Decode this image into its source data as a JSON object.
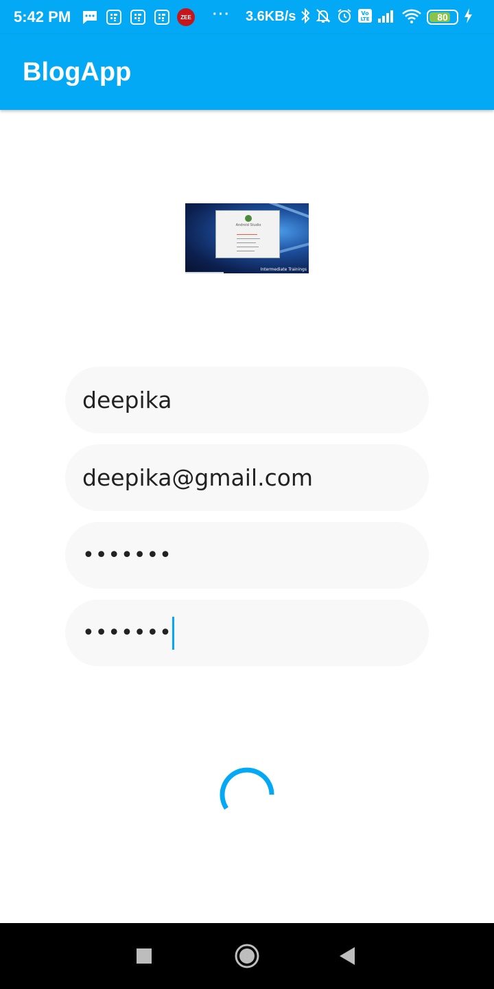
{
  "status_bar": {
    "time": "5:42 PM",
    "notification_icons": [
      "message-icon",
      "sim-icon",
      "sim-icon",
      "sim-icon",
      "zee-icon"
    ],
    "zee_label": "ZEE",
    "more": "···",
    "net_speed": "3.6KB/s",
    "right_icons": [
      "bluetooth-icon",
      "mute-icon",
      "alarm-icon",
      "volte-icon",
      "signal-icon",
      "wifi-icon"
    ],
    "battery": {
      "level_percent": 80,
      "label": "80"
    }
  },
  "app_bar": {
    "title": "BlogApp"
  },
  "logo": {
    "window_title": "Android Studio",
    "caption": "Intermediate Trainings"
  },
  "form": {
    "name_value": "deepika",
    "email_value": "deepika@gmail.com",
    "password_value": "•••••••",
    "confirm_value": "•••••••"
  },
  "loader": {
    "color": "#03A9F4",
    "state": "loading"
  },
  "nav_bar": {
    "buttons": [
      "recents-button",
      "home-button",
      "back-button"
    ]
  },
  "colors": {
    "primary": "#03A9F4",
    "field_bg": "#f8f8f8",
    "battery": "#8BC34A"
  }
}
